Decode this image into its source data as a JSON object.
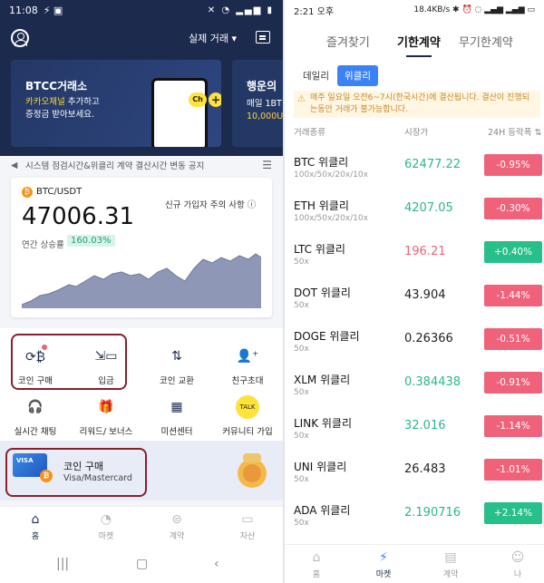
{
  "left": {
    "status": {
      "time": "11:08"
    },
    "header": {
      "mode_label": "실제 거래 ▾"
    },
    "banner1": {
      "title": "BTCC거래소",
      "line1_highlight": "카카오채널",
      "line1_rest": " 추가하고",
      "line2": "증정금 받아보세요."
    },
    "banner2": {
      "title": "행운의",
      "line1": "매일 1BT",
      "line2_highlight": "10,000U"
    },
    "notice": {
      "text": "시스템 점검시간&위클리 계약 결산시간 변동 공지"
    },
    "price_card": {
      "pair": "BTC/USDT",
      "notice_link": "신규 가입자 주의 사항 ⓘ",
      "price": "47006.31",
      "yr_label": "연간 상승률",
      "yr_value": "160.03%"
    },
    "menu": [
      {
        "label": "코인 구매",
        "icon": "coin-exchange-icon"
      },
      {
        "label": "입금",
        "icon": "deposit-icon"
      },
      {
        "label": "코인 교환",
        "icon": "swap-icon"
      },
      {
        "label": "친구초대",
        "icon": "add-friend-icon"
      },
      {
        "label": "실시간 채팅",
        "icon": "headset-icon"
      },
      {
        "label": "리워드/ 보너스",
        "icon": "gift-icon"
      },
      {
        "label": "미션센터",
        "icon": "calendar-icon"
      },
      {
        "label": "커뮤니티 가입",
        "icon": "talk-icon"
      }
    ],
    "promo": {
      "title": "코인 구매",
      "subtitle": "Visa/Mastercard",
      "card_text": "VISA"
    },
    "tabbar": [
      "홈",
      "마켓",
      "계약",
      "자산"
    ]
  },
  "right": {
    "status": {
      "time": "2:21 오후",
      "right": "18.4KB/s ✱ ⏰ ◌ ▂▄▆ ▂▄▆ ▭"
    },
    "tabs": [
      "즐겨찾기",
      "기한계약",
      "무기한계약"
    ],
    "segments": [
      "데일리",
      "위클리"
    ],
    "warning": "매주 일요일 오전6~7시(한국시간)에 결산됩니다. 결산이 진행되는동안 거래가 불가능합니다.",
    "columns": {
      "name": "거래종류",
      "price": "시장가",
      "change": "24H 등락폭 ⇅"
    },
    "rows": [
      {
        "name": "BTC 위클리",
        "lev": "100x/50x/20x/10x",
        "price": "62477.22",
        "change": "-0.95%",
        "pc": "#2cb884",
        "cc": "#f0627a"
      },
      {
        "name": "ETH 위클리",
        "lev": "100x/50x/20x/10x",
        "price": "4207.05",
        "change": "-0.30%",
        "pc": "#2cb884",
        "cc": "#f0627a"
      },
      {
        "name": "LTC 위클리",
        "lev": "50x",
        "price": "196.21",
        "change": "+0.40%",
        "pc": "#f0627a",
        "cc": "#27c08a"
      },
      {
        "name": "DOT 위클리",
        "lev": "50x",
        "price": "43.904",
        "change": "-1.44%",
        "pc": "#222222",
        "cc": "#f0627a"
      },
      {
        "name": "DOGE 위클리",
        "lev": "50x",
        "price": "0.26366",
        "change": "-0.51%",
        "pc": "#222222",
        "cc": "#f0627a"
      },
      {
        "name": "XLM 위클리",
        "lev": "50x",
        "price": "0.384438",
        "change": "-0.91%",
        "pc": "#2cb884",
        "cc": "#f0627a"
      },
      {
        "name": "LINK 위클리",
        "lev": "50x",
        "price": "32.016",
        "change": "-1.14%",
        "pc": "#2cb884",
        "cc": "#f0627a"
      },
      {
        "name": "UNI 위클리",
        "lev": "50x",
        "price": "26.483",
        "change": "-1.01%",
        "pc": "#222222",
        "cc": "#f0627a"
      },
      {
        "name": "ADA 위클리",
        "lev": "50x",
        "price": "2.190716",
        "change": "+2.14%",
        "pc": "#2cb884",
        "cc": "#27c08a"
      }
    ],
    "tabbar": [
      "홈",
      "마켓",
      "계약",
      "나"
    ]
  }
}
